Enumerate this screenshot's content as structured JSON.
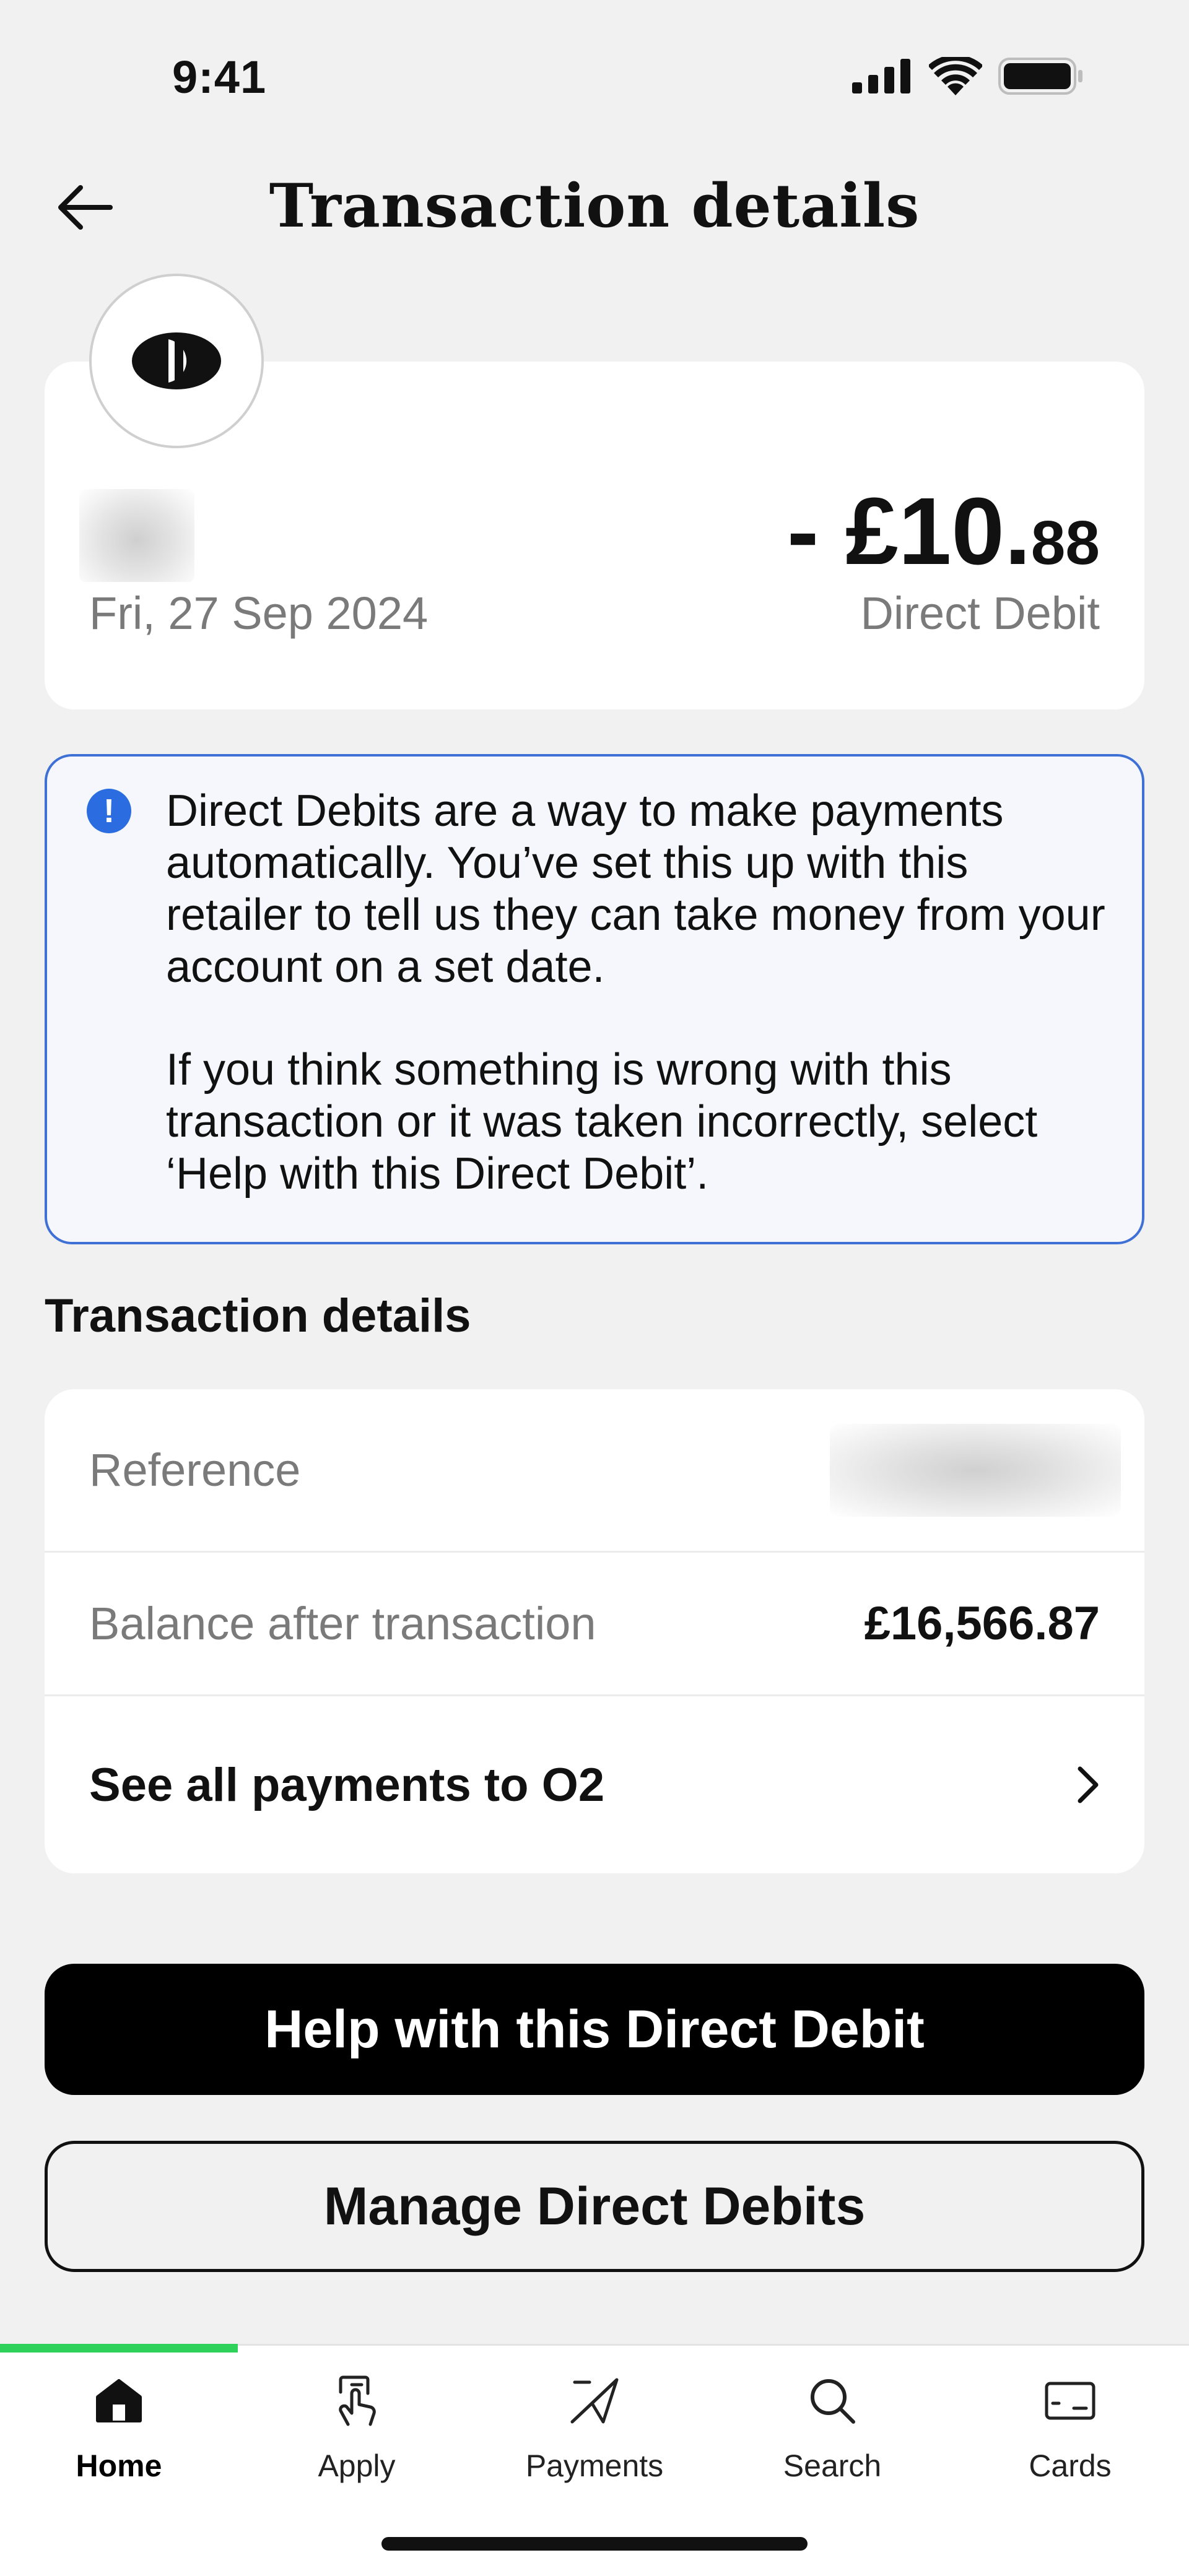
{
  "status_bar": {
    "time": "9:41"
  },
  "header": {
    "title": "Transaction details"
  },
  "summary": {
    "date": "Fri, 27 Sep 2024",
    "amount_main": "- £10.",
    "amount_pence": "88",
    "type": "Direct Debit"
  },
  "info": {
    "paragraph1": "Direct Debits are a way to make payments automatically. You’ve set this up with this retailer to tell us they can take money from your account on a set date.",
    "paragraph2": "If you think something is wrong with this transaction or it was taken incorrectly, select ‘Help with this Direct Debit’."
  },
  "details": {
    "heading": "Transaction details",
    "reference_label": "Reference",
    "balance_label": "Balance after transaction",
    "balance_value": "£16,566.87",
    "see_all_label": "See all payments to O2"
  },
  "actions": {
    "help_label": "Help with this Direct Debit",
    "manage_label": "Manage Direct Debits"
  },
  "nav": {
    "items": [
      {
        "label": "Home",
        "icon": "home-icon",
        "active": true
      },
      {
        "label": "Apply",
        "icon": "apply-icon",
        "active": false
      },
      {
        "label": "Payments",
        "icon": "payments-icon",
        "active": false
      },
      {
        "label": "Search",
        "icon": "search-icon",
        "active": false
      },
      {
        "label": "Cards",
        "icon": "card-icon",
        "active": false
      }
    ]
  },
  "colors": {
    "accent_green": "#2ed15a",
    "info_blue": "#2b6de0",
    "background": "#f1f1f1"
  }
}
